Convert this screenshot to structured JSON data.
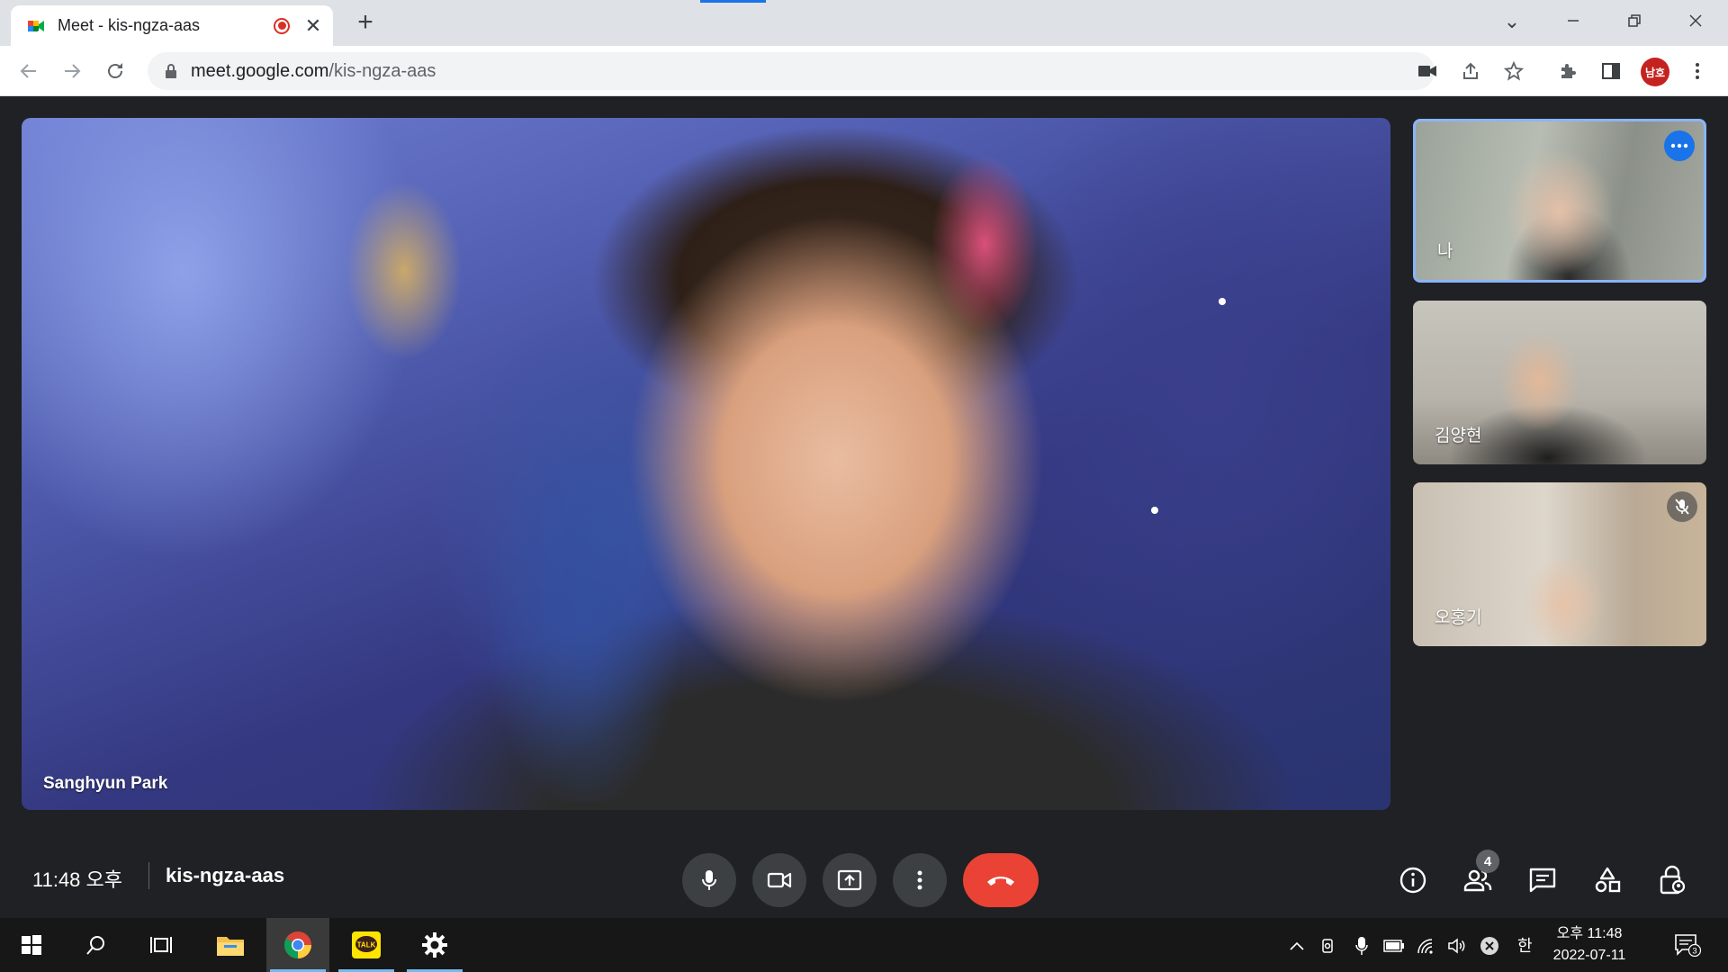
{
  "browser": {
    "tab_title": "Meet - kis-ngza-aas",
    "url_domain": "meet.google.com",
    "url_path": "/kis-ngza-aas",
    "profile_initials": "남호"
  },
  "meet": {
    "main_participant": "Sanghyun Park",
    "tiles": [
      {
        "name": "나"
      },
      {
        "name": "김양현"
      },
      {
        "name": "오홍기"
      }
    ],
    "time": "11:48 오후",
    "meeting_code": "kis-ngza-aas",
    "participant_count": "4",
    "colors": {
      "end_call": "#ea4335",
      "active_tile_border": "#8ab4f8",
      "accent": "#1a73e8"
    }
  },
  "taskbar": {
    "ime": "한",
    "clock_time": "오후 11:48",
    "clock_date": "2022-07-11",
    "notification_count": "3"
  }
}
